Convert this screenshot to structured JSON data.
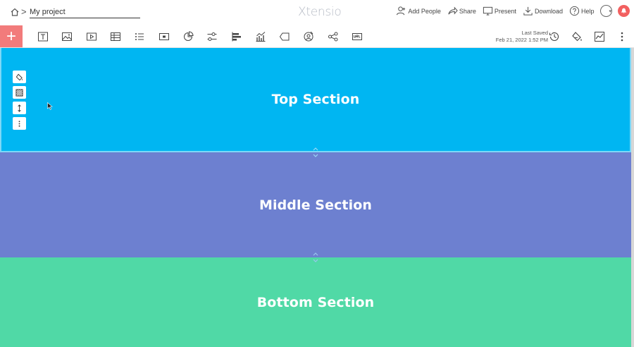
{
  "header": {
    "breadcrumb_separator": ">",
    "project_name": "My project",
    "brand": "Xtensio",
    "actions": [
      {
        "label": "Add People",
        "icon": "add-people-icon"
      },
      {
        "label": "Share",
        "icon": "share-icon"
      },
      {
        "label": "Present",
        "icon": "present-icon"
      },
      {
        "label": "Download",
        "icon": "download-icon"
      },
      {
        "label": "Help",
        "icon": "help-icon"
      }
    ]
  },
  "toolbar": {
    "add_label": "+",
    "tools": [
      "title-icon",
      "image-icon",
      "video-icon",
      "table-icon",
      "list-icon",
      "button-icon",
      "pie-chart-icon",
      "slider-icon",
      "bar-chart-icon",
      "column-chart-icon",
      "tag-icon",
      "persona-icon",
      "network-icon",
      "url-icon"
    ],
    "last_saved_label": "Last Saved",
    "last_saved_time": "Feb 21, 2022 1:52 PM"
  },
  "sections": {
    "top": {
      "title": "Top Section",
      "color": "#00b6f2"
    },
    "middle": {
      "title": "Middle Section",
      "color": "#6d80d0"
    },
    "bottom": {
      "title": "Bottom Section",
      "color": "#50d9a6"
    }
  },
  "colors": {
    "accent": "#f27b7b",
    "notification": "#f26060"
  }
}
